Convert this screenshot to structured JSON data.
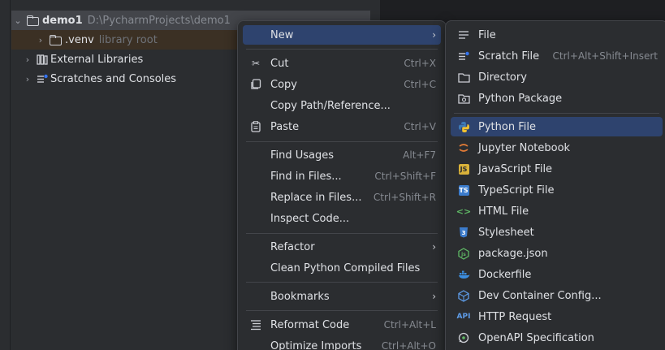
{
  "project_tree": {
    "root": {
      "name": "demo1",
      "path": "D:\\PycharmProjects\\demo1"
    },
    "venv": {
      "name": ".venv",
      "hint": "library root"
    },
    "external_libraries": "External Libraries",
    "scratches": "Scratches and Consoles"
  },
  "context_menu": {
    "items": [
      {
        "label": "New",
        "shortcut": "",
        "icon": "",
        "submenu": true
      },
      {
        "label": "Cut",
        "shortcut": "Ctrl+X",
        "icon": "scissors-icon"
      },
      {
        "label": "Copy",
        "shortcut": "Ctrl+C",
        "icon": "copy-icon"
      },
      {
        "label": "Copy Path/Reference...",
        "shortcut": "",
        "icon": ""
      },
      {
        "label": "Paste",
        "shortcut": "Ctrl+V",
        "icon": "clipboard-icon"
      },
      {
        "label": "Find Usages",
        "shortcut": "Alt+F7",
        "icon": ""
      },
      {
        "label": "Find in Files...",
        "shortcut": "Ctrl+Shift+F",
        "icon": ""
      },
      {
        "label": "Replace in Files...",
        "shortcut": "Ctrl+Shift+R",
        "icon": ""
      },
      {
        "label": "Inspect Code...",
        "shortcut": "",
        "icon": ""
      },
      {
        "label": "Refactor",
        "shortcut": "",
        "icon": "",
        "submenu": true
      },
      {
        "label": "Clean Python Compiled Files",
        "shortcut": "",
        "icon": ""
      },
      {
        "label": "Bookmarks",
        "shortcut": "",
        "icon": "",
        "submenu": true
      },
      {
        "label": "Reformat Code",
        "shortcut": "Ctrl+Alt+L",
        "icon": "reformat-icon"
      },
      {
        "label": "Optimize Imports",
        "shortcut": "Ctrl+Alt+O",
        "icon": ""
      }
    ]
  },
  "new_submenu": {
    "items": [
      {
        "label": "File",
        "shortcut": "",
        "icon": "file-lines-icon"
      },
      {
        "label": "Scratch File",
        "shortcut": "Ctrl+Alt+Shift+Insert",
        "icon": "scratch-file-icon"
      },
      {
        "label": "Directory",
        "shortcut": "",
        "icon": "folder-icon"
      },
      {
        "label": "Python Package",
        "shortcut": "",
        "icon": "package-folder-icon"
      },
      {
        "label": "Python File",
        "shortcut": "",
        "icon": "python-icon"
      },
      {
        "label": "Jupyter Notebook",
        "shortcut": "",
        "icon": "jupyter-icon"
      },
      {
        "label": "JavaScript File",
        "shortcut": "",
        "icon": "javascript-icon"
      },
      {
        "label": "TypeScript File",
        "shortcut": "",
        "icon": "typescript-icon"
      },
      {
        "label": "HTML File",
        "shortcut": "",
        "icon": "html-icon"
      },
      {
        "label": "Stylesheet",
        "shortcut": "",
        "icon": "css-icon"
      },
      {
        "label": "package.json",
        "shortcut": "",
        "icon": "nodejs-icon"
      },
      {
        "label": "Dockerfile",
        "shortcut": "",
        "icon": "docker-icon"
      },
      {
        "label": "Dev Container Config...",
        "shortcut": "",
        "icon": "dev-container-icon"
      },
      {
        "label": "HTTP Request",
        "shortcut": "",
        "icon": "api-icon"
      },
      {
        "label": "OpenAPI Specification",
        "shortcut": "",
        "icon": "openapi-icon"
      }
    ]
  },
  "colors": {
    "highlight": "#2e436e",
    "panel": "#2b2d30",
    "editor": "#1e1f22"
  }
}
